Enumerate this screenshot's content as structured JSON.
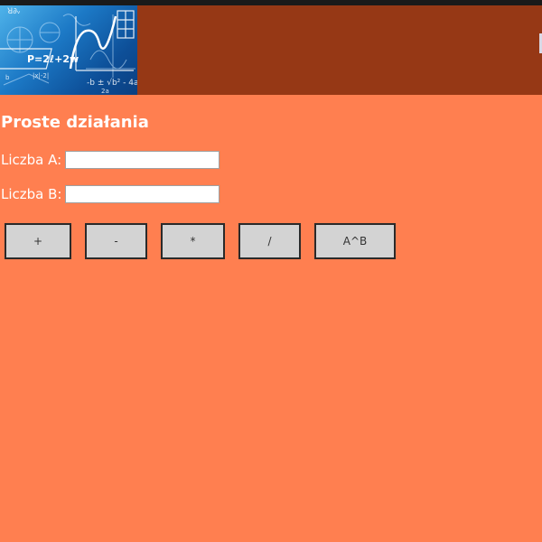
{
  "header": {
    "logo": {
      "formula": "P=2ℓ+2w",
      "icon": "math-chalkboard-logo"
    }
  },
  "main": {
    "title": "Proste działania",
    "field_a": {
      "label": "Liczba A:",
      "value": ""
    },
    "field_b": {
      "label": "Liczba B:",
      "value": ""
    },
    "buttons": {
      "add": "+",
      "subtract": "-",
      "multiply": "*",
      "divide": "/",
      "power": "A^B"
    }
  },
  "colors": {
    "page_background": "#ff7f50",
    "header_background": "#963815",
    "button_background": "#d3d3d3"
  }
}
